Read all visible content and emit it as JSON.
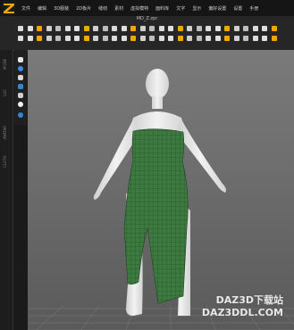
{
  "app": {
    "logo_letter": "Z",
    "accent_color": "#f0a800",
    "filename": "MD_Z.zpr"
  },
  "menu": {
    "items": [
      "文件",
      "编辑",
      "3D服装",
      "2D板片",
      "缝纫",
      "素材",
      "虚拟模特",
      "面料库",
      "文字",
      "显示",
      "偏好设置",
      "设置",
      "手册"
    ]
  },
  "left_panel": {
    "tab_labels": [
      "MODE",
      "LOC",
      "AVATAR",
      "CLOTH"
    ]
  },
  "palette": {
    "buttons": [
      "cursor-icon",
      "circle-icon",
      "person-icon",
      "move-icon",
      "pin-icon",
      "light-icon",
      "sphere-icon"
    ]
  },
  "watermark": {
    "line1": "DAZ3D下载站",
    "line2": "DAZ3DDL.COM"
  },
  "colors": {
    "dress_green": "#3c7a40",
    "avatar_white": "#e9e9e9",
    "background_top": "#7a7a7a"
  }
}
